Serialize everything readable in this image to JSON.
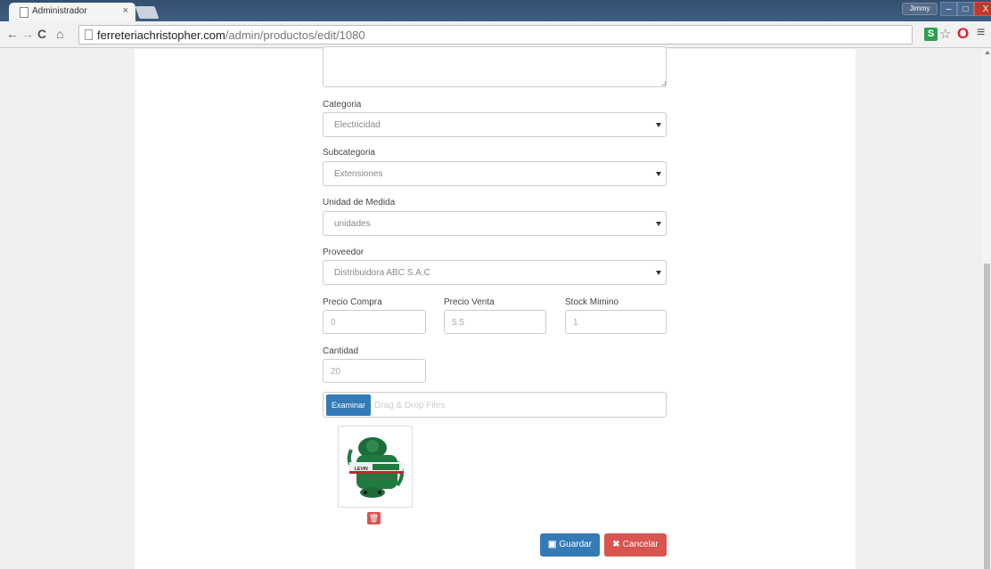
{
  "browser": {
    "tab_title": "Administrador",
    "tab_close": "×",
    "url_host": "ferreteriachristopher.com",
    "url_path": "/admin/productos/edit/1080",
    "user_label": "Jimmy",
    "nav_back": "←",
    "nav_forward": "→",
    "nav_reload": "C",
    "nav_home": "⌂",
    "ext_label": "S",
    "star": "☆",
    "opera": "O",
    "menu": "≡",
    "window_minimize": "–",
    "window_maximize": "□",
    "window_close": "X"
  },
  "form": {
    "categoria": {
      "label": "Categoria",
      "value": "Electricidad"
    },
    "subcategoria": {
      "label": "Subcategoria",
      "value": "Extensiones"
    },
    "unidad": {
      "label": "Unidad de Medida",
      "value": "unidades"
    },
    "proveedor": {
      "label": "Proveedor",
      "value": "Distribuidora ABC S.A.C"
    },
    "precio_compra": {
      "label": "Precio Compra",
      "value": "0"
    },
    "precio_venta": {
      "label": "Precio Venta",
      "value": "5.5"
    },
    "stock_minimo": {
      "label": "Stock Mimino",
      "value": "1"
    },
    "cantidad": {
      "label": "Cantidad",
      "value": "20"
    },
    "file": {
      "button_label": "Examinar",
      "placeholder": "Drag & Drop Files"
    }
  },
  "product_image": {
    "band_text": "LEVIN"
  },
  "actions": {
    "delete_icon": "🗑",
    "save_icon": "▣",
    "save_label": "Guardar",
    "cancel_icon": "✖",
    "cancel_label": "Cancelar"
  },
  "colors": {
    "primary": "#337ab7",
    "danger": "#d9534f"
  }
}
